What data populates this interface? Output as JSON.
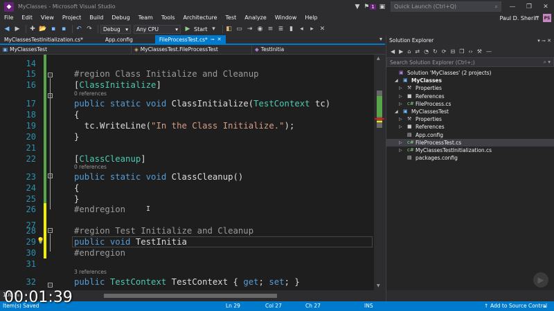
{
  "window": {
    "title": "MyClasses - Microsoft Visual Studio",
    "notification_count": "1",
    "quick_launch_placeholder": "Quick Launch (Ctrl+Q)"
  },
  "menu": {
    "items": [
      "File",
      "Edit",
      "View",
      "Project",
      "Build",
      "Debug",
      "Team",
      "Tools",
      "Architecture",
      "Test",
      "Analyze",
      "Window",
      "Help"
    ],
    "user_name": "Paul D. Sheriff",
    "user_initials": "PS"
  },
  "toolbar": {
    "configuration": "Debug",
    "platform": "Any CPU",
    "start_label": "Start"
  },
  "tabs": [
    {
      "label": "MyClassesTestInitialization.cs*",
      "active": false,
      "closable": false
    },
    {
      "label": "App.config",
      "active": false,
      "closable": false
    },
    {
      "label": "FileProcessTest.cs*",
      "active": true,
      "closable": true
    }
  ],
  "navbar": {
    "project": "MyClassesTest",
    "type": "MyClassesTest.FileProcessTest",
    "member": "TestInitia"
  },
  "editor": {
    "lines": [
      {
        "num": "14",
        "parts": [],
        "refs": ""
      },
      {
        "num": "15",
        "parts": [
          {
            "t": "#region Class Initialize and Cleanup",
            "c": "grey"
          }
        ],
        "refs": ""
      },
      {
        "num": "16",
        "parts": [
          {
            "t": "[",
            "c": ""
          },
          {
            "t": "ClassInitialize",
            "c": "typ"
          },
          {
            "t": "]",
            "c": ""
          }
        ],
        "refs": "0 references"
      },
      {
        "num": "17",
        "parts": [
          {
            "t": "public static void ",
            "c": "kw"
          },
          {
            "t": "ClassInitialize(",
            "c": ""
          },
          {
            "t": "TestContext",
            "c": "typ"
          },
          {
            "t": " tc)",
            "c": ""
          }
        ],
        "refs": ""
      },
      {
        "num": "18",
        "parts": [
          {
            "t": "{",
            "c": ""
          }
        ],
        "refs": ""
      },
      {
        "num": "19",
        "parts": [
          {
            "t": "  tc.WriteLine(",
            "c": ""
          },
          {
            "t": "\"In the Class Initialize.\"",
            "c": "str"
          },
          {
            "t": ");",
            "c": ""
          }
        ],
        "refs": ""
      },
      {
        "num": "20",
        "parts": [
          {
            "t": "}",
            "c": ""
          }
        ],
        "refs": ""
      },
      {
        "num": "21",
        "parts": [],
        "refs": ""
      },
      {
        "num": "22",
        "parts": [
          {
            "t": "[",
            "c": ""
          },
          {
            "t": "ClassCleanup",
            "c": "typ"
          },
          {
            "t": "]",
            "c": ""
          }
        ],
        "refs": "0 references"
      },
      {
        "num": "23",
        "parts": [
          {
            "t": "public static void ",
            "c": "kw"
          },
          {
            "t": "ClassCleanup()",
            "c": ""
          }
        ],
        "refs": ""
      },
      {
        "num": "24",
        "parts": [
          {
            "t": "{",
            "c": ""
          }
        ],
        "refs": ""
      },
      {
        "num": "25",
        "parts": [
          {
            "t": "}",
            "c": ""
          }
        ],
        "refs": ""
      },
      {
        "num": "26",
        "parts": [
          {
            "t": "#endregion",
            "c": "grey"
          }
        ],
        "refs": ""
      },
      {
        "num": "27",
        "parts": [],
        "refs": ""
      },
      {
        "num": "28",
        "parts": [
          {
            "t": "#region Test Initialize and Cleanup",
            "c": "grey"
          }
        ],
        "refs": ""
      },
      {
        "num": "29",
        "parts": [
          {
            "t": "public void ",
            "c": "kw"
          },
          {
            "t": "TestInitia",
            "c": ""
          }
        ],
        "refs": ""
      },
      {
        "num": "30",
        "parts": [
          {
            "t": "#endregion",
            "c": "grey"
          }
        ],
        "refs": ""
      },
      {
        "num": "31",
        "parts": [],
        "refs": "3 references"
      },
      {
        "num": "32",
        "parts": [
          {
            "t": "public ",
            "c": "kw"
          },
          {
            "t": "TestContext",
            "c": "typ"
          },
          {
            "t": " TestContext { ",
            "c": ""
          },
          {
            "t": "get",
            "c": "kw"
          },
          {
            "t": "; ",
            "c": ""
          },
          {
            "t": "set",
            "c": "kw"
          },
          {
            "t": "; }",
            "c": ""
          }
        ],
        "refs": ""
      }
    ],
    "zoom": "100 %"
  },
  "solution_explorer": {
    "title": "Solution Explorer",
    "search_placeholder": "Search Solution Explorer (Ctrl+;)",
    "tree": [
      {
        "label": "Solution 'MyClasses' (2 projects)",
        "level": 0,
        "icon": "solution-icon",
        "arrow": "",
        "bold": false,
        "selected": false
      },
      {
        "label": "MyClasses",
        "level": 1,
        "icon": "csharp-project-icon",
        "arrow": "expanded",
        "bold": true,
        "selected": false
      },
      {
        "label": "Properties",
        "level": 2,
        "icon": "wrench-icon",
        "arrow": "collapsed",
        "bold": false,
        "selected": false
      },
      {
        "label": "References",
        "level": 2,
        "icon": "references-icon",
        "arrow": "collapsed",
        "bold": false,
        "selected": false
      },
      {
        "label": "FileProcess.cs",
        "level": 2,
        "icon": "csharp-file-icon",
        "arrow": "collapsed",
        "bold": false,
        "selected": false
      },
      {
        "label": "MyClassesTest",
        "level": 1,
        "icon": "test-project-icon",
        "arrow": "expanded",
        "bold": false,
        "selected": false
      },
      {
        "label": "Properties",
        "level": 2,
        "icon": "wrench-icon",
        "arrow": "collapsed",
        "bold": false,
        "selected": false
      },
      {
        "label": "References",
        "level": 2,
        "icon": "references-icon",
        "arrow": "collapsed",
        "bold": false,
        "selected": false
      },
      {
        "label": "App.config",
        "level": 2,
        "icon": "config-file-icon",
        "arrow": "",
        "bold": false,
        "selected": false
      },
      {
        "label": "FileProcessTest.cs",
        "level": 2,
        "icon": "csharp-file-icon",
        "arrow": "collapsed",
        "bold": false,
        "selected": true
      },
      {
        "label": "MyClassesTestInitialization.cs",
        "level": 2,
        "icon": "csharp-file-icon",
        "arrow": "collapsed",
        "bold": false,
        "selected": false
      },
      {
        "label": "packages.config",
        "level": 2,
        "icon": "config-file-icon",
        "arrow": "",
        "bold": false,
        "selected": false
      }
    ]
  },
  "statusbar": {
    "message": "Item(s) Saved",
    "ln": "Ln 29",
    "col": "Col 27",
    "ch": "Ch 27",
    "mode": "INS",
    "source_control": "Add to Source Control"
  },
  "overlay": {
    "video_time": "00:01:39"
  },
  "colors": {
    "accent": "#007acc",
    "brand": "#68217a",
    "editor_bg": "#1e1e1e"
  }
}
